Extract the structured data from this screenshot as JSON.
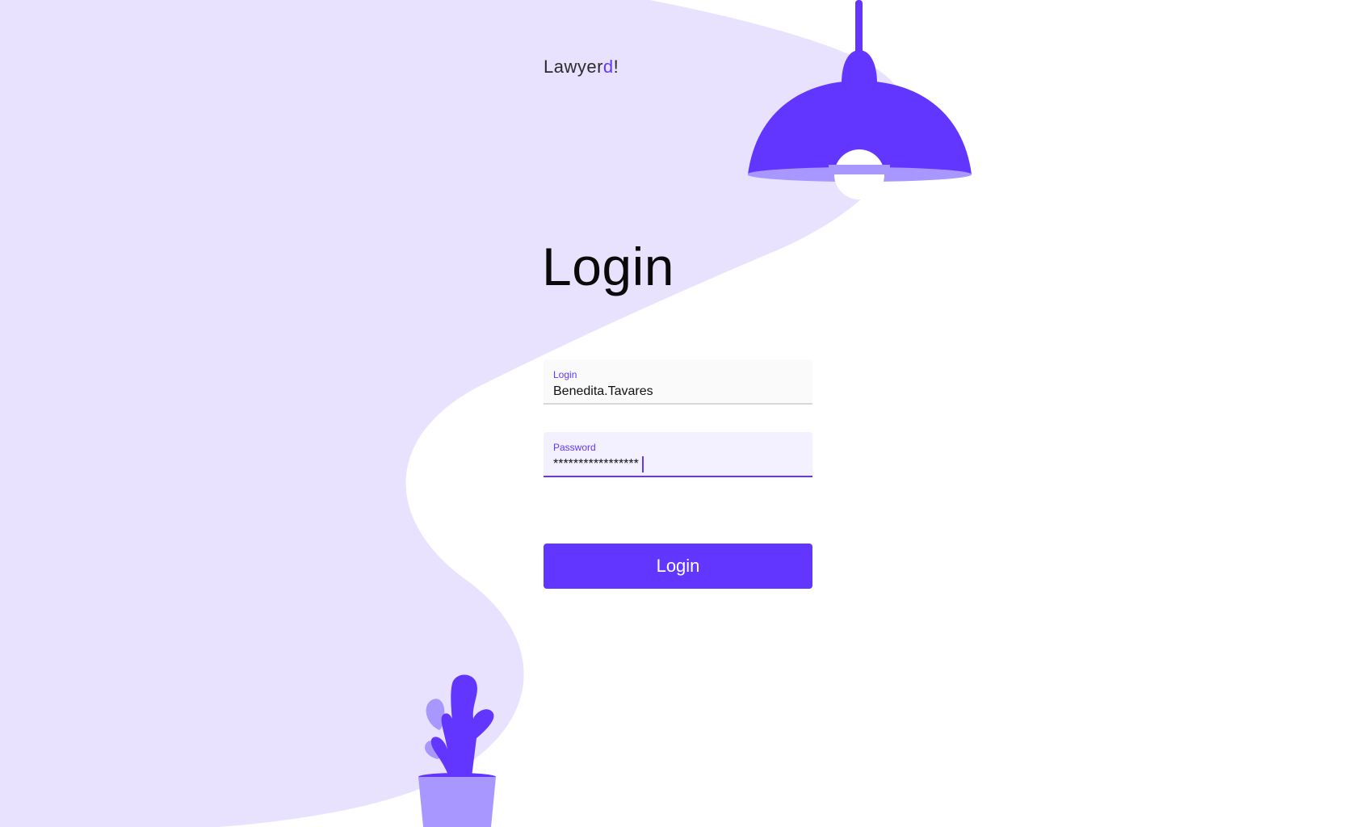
{
  "brand": {
    "logo_prefix": "Lawyer",
    "logo_accent": "d",
    "logo_suffix": "!"
  },
  "page": {
    "title": "Login"
  },
  "form": {
    "login_label": "Login",
    "login_value": "Benedita.Tavares",
    "password_label": "Password",
    "password_value": "*****************",
    "submit_label": "Login"
  },
  "colors": {
    "accent": "#6236ff",
    "accent_light": "#e8e2ff",
    "accent_mid": "#a797ff"
  },
  "icons": [
    "lamp-illustration",
    "plant-illustration"
  ]
}
